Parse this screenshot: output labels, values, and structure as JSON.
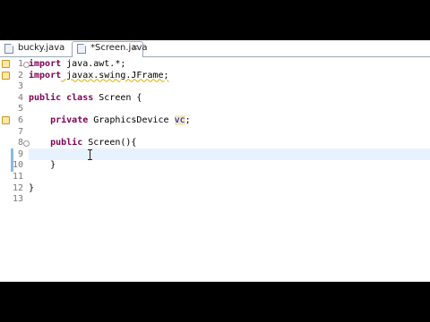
{
  "tabs": [
    {
      "label": "bucky.java",
      "active": false
    },
    {
      "label": "*Screen.java",
      "active": true,
      "close": "×"
    }
  ],
  "lines": [
    {
      "num": "1",
      "parts": [
        {
          "t": "import",
          "c": "kw"
        },
        {
          "t": " java.awt.*;",
          "c": ""
        }
      ]
    },
    {
      "num": "2",
      "parts": [
        {
          "t": "import",
          "c": "kw"
        },
        {
          "t": " javax.swing.JFrame;",
          "c": "warn"
        }
      ]
    },
    {
      "num": "3",
      "parts": []
    },
    {
      "num": "4",
      "parts": [
        {
          "t": "public class",
          "c": "kw"
        },
        {
          "t": " Screen {",
          "c": ""
        }
      ]
    },
    {
      "num": "5",
      "parts": []
    },
    {
      "num": "6",
      "parts": [
        {
          "t": "    ",
          "c": ""
        },
        {
          "t": "private",
          "c": "kw"
        },
        {
          "t": " GraphicsDevice ",
          "c": ""
        },
        {
          "t": "vc",
          "c": "fld hilite"
        },
        {
          "t": ";",
          "c": ""
        }
      ]
    },
    {
      "num": "7",
      "parts": []
    },
    {
      "num": "8",
      "parts": [
        {
          "t": "    ",
          "c": ""
        },
        {
          "t": "public",
          "c": "kw"
        },
        {
          "t": " Screen(){",
          "c": ""
        }
      ]
    },
    {
      "num": "9",
      "parts": []
    },
    {
      "num": "10",
      "parts": [
        {
          "t": "    }",
          "c": ""
        }
      ]
    },
    {
      "num": "11",
      "parts": []
    },
    {
      "num": "12",
      "parts": [
        {
          "t": "}",
          "c": ""
        }
      ]
    },
    {
      "num": "13",
      "parts": []
    }
  ],
  "markers": {
    "warning_lines": [
      "1",
      "2",
      "6"
    ]
  }
}
